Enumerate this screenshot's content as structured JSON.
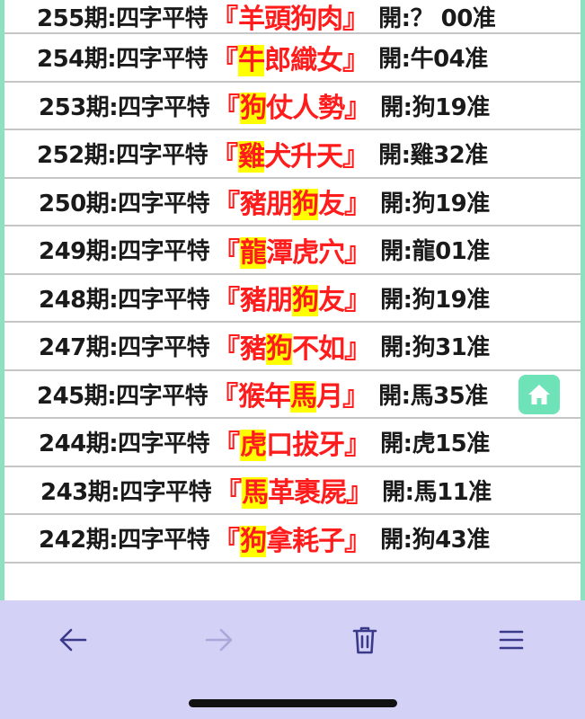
{
  "rows": [
    {
      "period": "255期:四字平特",
      "open": "『",
      "c": [
        "羊",
        "頭",
        "狗",
        "肉"
      ],
      "hl": -1,
      "close": "』",
      "result": "開:？ 00准",
      "lead": 36
    },
    {
      "period": "254期:四字平特",
      "open": "『",
      "c": [
        "牛",
        "郎",
        "織",
        "女"
      ],
      "hl": 0,
      "close": "』",
      "result": "開:牛04准",
      "lead": 36
    },
    {
      "period": "253期:四字平特",
      "open": "『",
      "c": [
        "狗",
        "仗",
        "人",
        "勢"
      ],
      "hl": 0,
      "close": "』",
      "result": "開:狗19准",
      "lead": 38
    },
    {
      "period": "252期:四字平特",
      "open": "『",
      "c": [
        "雞",
        "犬",
        "升",
        "天"
      ],
      "hl": 0,
      "close": "』",
      "result": "開:雞32准",
      "lead": 36
    },
    {
      "period": "250期:四字平特",
      "open": "『",
      "c": [
        "豬",
        "朋",
        "狗",
        "友"
      ],
      "hl": 2,
      "close": "』",
      "result": "開:狗19准",
      "lead": 38
    },
    {
      "period": "249期:四字平特",
      "open": "『",
      "c": [
        "龍",
        "潭",
        "虎",
        "穴"
      ],
      "hl": 0,
      "close": "』",
      "result": "開:龍01准",
      "lead": 38
    },
    {
      "period": "248期:四字平特",
      "open": "『",
      "c": [
        "豬",
        "朋",
        "狗",
        "友"
      ],
      "hl": 2,
      "close": "』",
      "result": "開:狗19准",
      "lead": 38
    },
    {
      "period": "247期:四字平特",
      "open": "『",
      "c": [
        "豬",
        "狗",
        "不",
        "如"
      ],
      "hl": 1,
      "close": "』",
      "result": "開:狗31准",
      "lead": 38
    },
    {
      "period": "245期:四字平特",
      "open": "『",
      "c": [
        "猴",
        "年",
        "馬",
        "月"
      ],
      "hl": 2,
      "close": "』",
      "result": "開:馬35准",
      "lead": 36
    },
    {
      "period": "244期:四字平特",
      "open": "『",
      "c": [
        "虎",
        "口",
        "拔",
        "牙"
      ],
      "hl": 0,
      "close": "』",
      "result": "開:虎15准",
      "lead": 38
    },
    {
      "period": "243期:四字平特",
      "open": "『",
      "c": [
        "馬",
        "革",
        "裹",
        "屍"
      ],
      "hl": 0,
      "close": "』",
      "result": "開:馬11准",
      "lead": 40
    },
    {
      "period": "242期:四字平特",
      "open": "『",
      "c": [
        "狗",
        "拿",
        "耗",
        "子"
      ],
      "hl": 0,
      "close": "』",
      "result": "開:狗43准",
      "lead": 38
    }
  ],
  "icons": {
    "home": "home-icon",
    "back": "arrow-left-icon",
    "forward": "arrow-right-icon",
    "delete": "trash-icon",
    "menu": "menu-icon"
  },
  "colors": {
    "highlight": "#ffff00",
    "phrase": "#ff1c1c",
    "toolbar": "#d3d1f6",
    "home_button": "#6fe3b8"
  }
}
